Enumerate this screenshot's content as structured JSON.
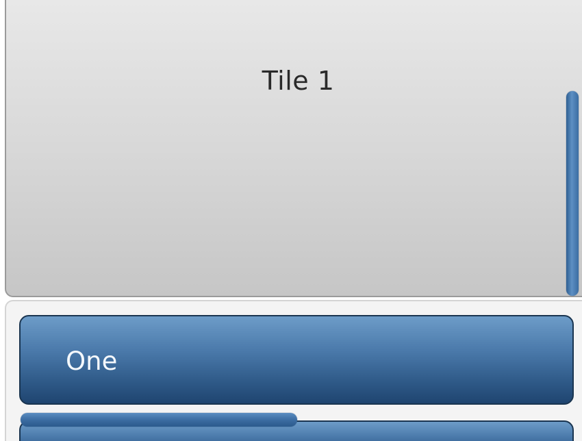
{
  "tile": {
    "title": "Tile 1"
  },
  "list": {
    "items": [
      {
        "label": "One"
      },
      {
        "label": ""
      }
    ]
  },
  "colors": {
    "accent": "#4a79aa",
    "tile_background": "#d8d8d8"
  }
}
